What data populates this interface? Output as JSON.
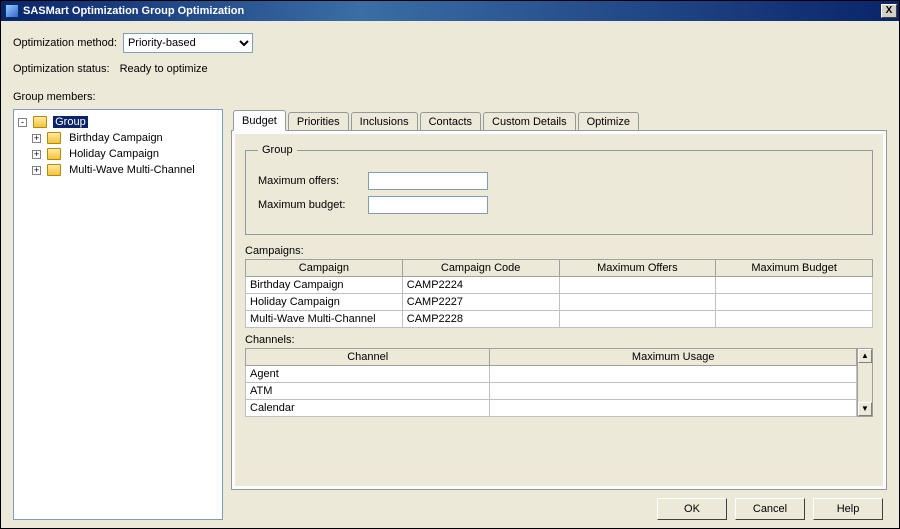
{
  "window": {
    "title": "SASMart Optimization Group Optimization",
    "close": "X"
  },
  "form": {
    "optMethodLabel": "Optimization method:",
    "optMethodValue": "Priority-based",
    "optStatusLabel": "Optimization status:",
    "optStatusValue": "Ready to optimize",
    "groupMembersLabel": "Group members:"
  },
  "tree": {
    "root": {
      "label": "Group",
      "toggle": "-"
    },
    "children": [
      {
        "label": "Birthday Campaign",
        "toggle": "+"
      },
      {
        "label": "Holiday Campaign",
        "toggle": "+"
      },
      {
        "label": "Multi-Wave Multi-Channel",
        "toggle": "+"
      }
    ]
  },
  "tabs": {
    "items": [
      {
        "label": "Budget"
      },
      {
        "label": "Priorities"
      },
      {
        "label": "Inclusions"
      },
      {
        "label": "Contacts"
      },
      {
        "label": "Custom Details"
      },
      {
        "label": "Optimize"
      }
    ],
    "activeIndex": 0
  },
  "budgetTab": {
    "groupBox": {
      "legend": "Group",
      "maxOffersLabel": "Maximum offers:",
      "maxOffersValue": "",
      "maxBudgetLabel": "Maximum budget:",
      "maxBudgetValue": ""
    },
    "campaigns": {
      "label": "Campaigns:",
      "headers": {
        "campaign": "Campaign",
        "code": "Campaign Code",
        "maxOffers": "Maximum Offers",
        "maxBudget": "Maximum Budget"
      },
      "rows": [
        {
          "campaign": "Birthday Campaign",
          "code": "CAMP2224",
          "maxOffers": "",
          "maxBudget": ""
        },
        {
          "campaign": "Holiday Campaign",
          "code": "CAMP2227",
          "maxOffers": "",
          "maxBudget": ""
        },
        {
          "campaign": "Multi-Wave Multi-Channel",
          "code": "CAMP2228",
          "maxOffers": "",
          "maxBudget": ""
        }
      ]
    },
    "channels": {
      "label": "Channels:",
      "headers": {
        "channel": "Channel",
        "maxUsage": "Maximum Usage"
      },
      "rows": [
        {
          "channel": "Agent",
          "maxUsage": ""
        },
        {
          "channel": "ATM",
          "maxUsage": ""
        },
        {
          "channel": "Calendar",
          "maxUsage": ""
        }
      ]
    }
  },
  "buttons": {
    "ok": "OK",
    "cancel": "Cancel",
    "help": "Help"
  }
}
